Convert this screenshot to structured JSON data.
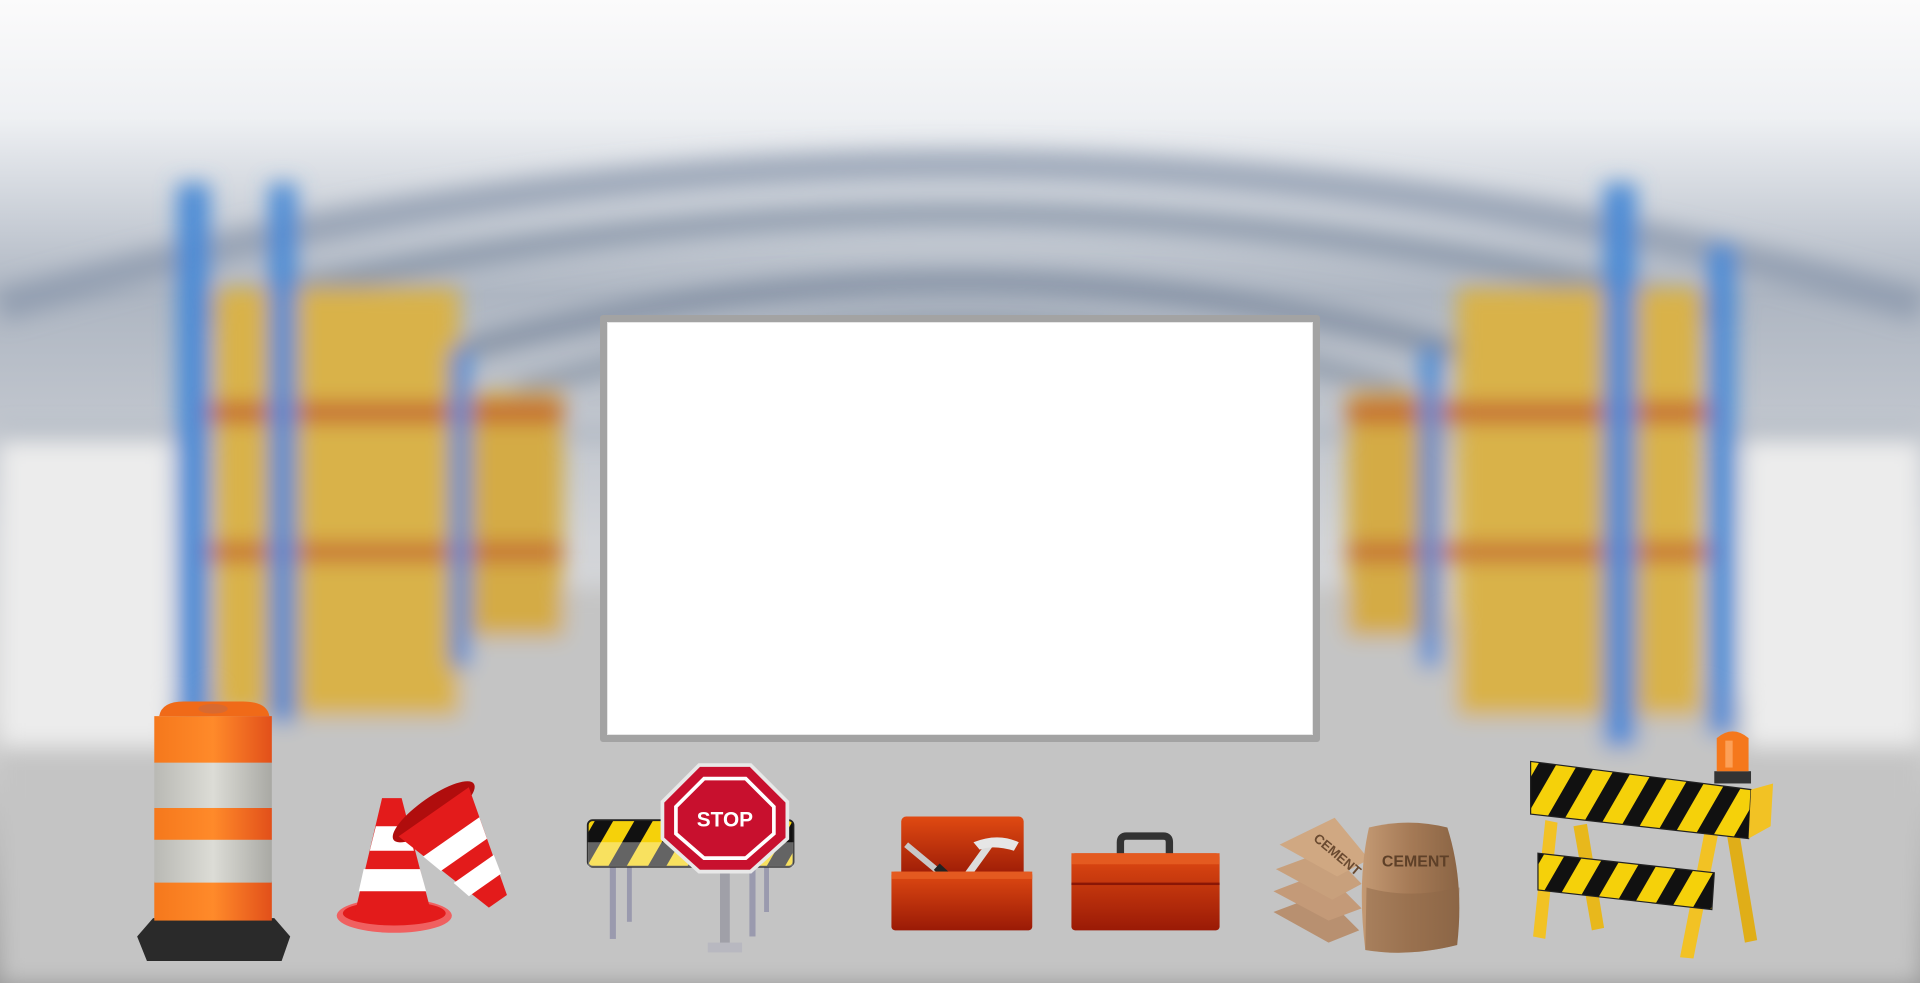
{
  "scene": {
    "background": "blurred warehouse aisle with shelving",
    "colors": {
      "frame_border": "#a3a3a3",
      "frame_fill": "#ffffff",
      "shelf_post": "#4a8ad6",
      "shelf_beam": "#c0502a",
      "boxes": "#d9b24a",
      "floor": "#b9b9b9"
    }
  },
  "content_frame": {
    "state": "empty"
  },
  "props": {
    "stop_sign_text": "STOP",
    "cement_bag_text": "CEMENT",
    "cement_stack_text": "CEMENT"
  },
  "icons": [
    "traffic-barrel-icon",
    "traffic-cones-icon",
    "stop-barrier-icon",
    "open-toolbox-icon",
    "closed-toolbox-icon",
    "cement-bags-icon",
    "warning-barricade-icon"
  ]
}
